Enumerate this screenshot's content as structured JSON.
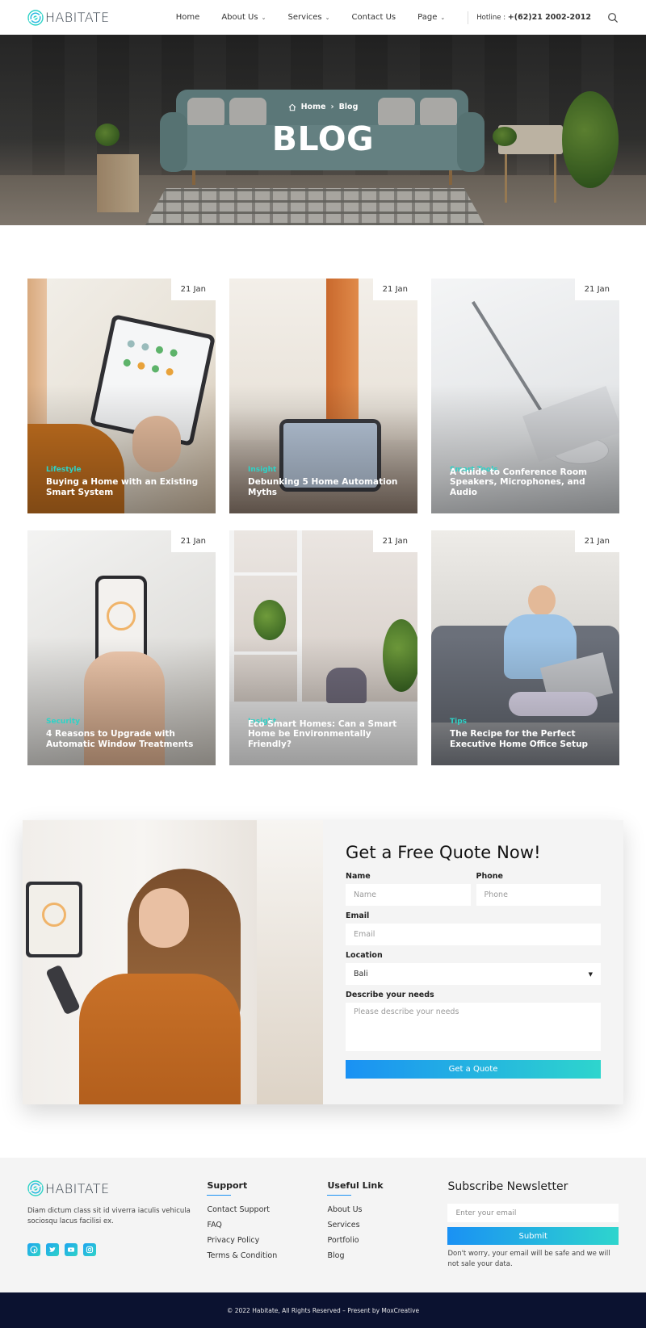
{
  "brand": {
    "name": "HABITATE",
    "accent": "#2ed3c7",
    "gradient_start": "#1a91f4",
    "gradient_end": "#2ed5cd"
  },
  "nav": {
    "items": [
      {
        "label": "Home",
        "dropdown": false
      },
      {
        "label": "About Us",
        "dropdown": true
      },
      {
        "label": "Services",
        "dropdown": true
      },
      {
        "label": "Contact Us",
        "dropdown": false
      },
      {
        "label": "Page",
        "dropdown": true
      }
    ],
    "hotline_label": "Hotline :",
    "hotline_number": "+(62)21 2002-2012",
    "search_icon": "search-icon"
  },
  "hero": {
    "breadcrumb_home": "Home",
    "breadcrumb_current": "Blog",
    "title": "BLOG"
  },
  "posts": [
    {
      "date": "21 Jan",
      "category": "Lifestyle",
      "title": "Buying a Home with an Existing Smart System"
    },
    {
      "date": "21 Jan",
      "category": "Insight",
      "title": "Debunking 5 Home Automation Myths"
    },
    {
      "date": "21 Jan",
      "category": "Smart Tools",
      "title": "A Guide to Conference Room Speakers, Microphones, and Audio"
    },
    {
      "date": "21 Jan",
      "category": "Security",
      "title": "4 Reasons to Upgrade with Automatic Window Treatments"
    },
    {
      "date": "21 Jan",
      "category": "Insight",
      "title": "Eco Smart Homes: Can a Smart Home be Environmentally Friendly?"
    },
    {
      "date": "21 Jan",
      "category": "Tips",
      "title": "The Recipe for the Perfect Executive Home Office Setup"
    }
  ],
  "quote": {
    "title": "Get a Free Quote Now!",
    "name_label": "Name",
    "name_placeholder": "Name",
    "phone_label": "Phone",
    "phone_placeholder": "Phone",
    "email_label": "Email",
    "email_placeholder": "Email",
    "location_label": "Location",
    "location_value": "Bali",
    "needs_label": "Describe your needs",
    "needs_placeholder": "Please describe your needs",
    "button": "Get a Quote"
  },
  "footer": {
    "description": "Diam dictum class sit id viverra iaculis vehicula sociosqu lacus facilisi ex.",
    "socials": [
      "facebook-icon",
      "twitter-icon",
      "youtube-icon",
      "instagram-icon"
    ],
    "support": {
      "heading": "Support",
      "links": [
        "Contact Support",
        "FAQ",
        "Privacy Policy",
        "Terms & Condition"
      ]
    },
    "useful": {
      "heading": "Useful Link",
      "links": [
        "About Us",
        "Services",
        "Portfolio",
        "Blog"
      ]
    },
    "newsletter": {
      "heading": "Subscribe Newsletter",
      "placeholder": "Enter your email",
      "button": "Submit",
      "note": "Don't worry, your email will be safe and we will not sale your data."
    },
    "copyright": "© 2022 Habitate, All Rights Reserved – Present by MoxCreative"
  }
}
